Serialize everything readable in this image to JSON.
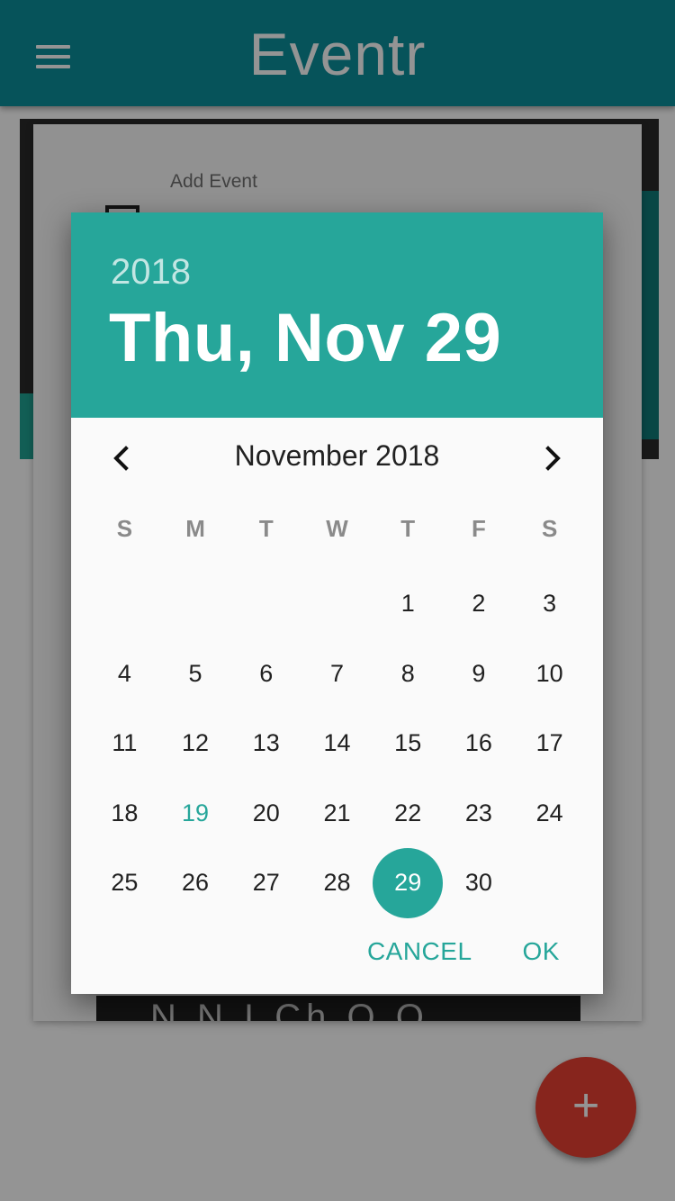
{
  "app_bar": {
    "title": "Eventr"
  },
  "background": {
    "add_event_label": "Add Event",
    "bottom_partial_text": "N N I Ch O O"
  },
  "fab": {
    "label": "+"
  },
  "dialog": {
    "header": {
      "year": "2018",
      "date": "Thu, Nov 29"
    },
    "month_label": "November 2018",
    "weekdays": [
      "S",
      "M",
      "T",
      "W",
      "T",
      "F",
      "S"
    ],
    "leading_blanks": 4,
    "days": [
      "1",
      "2",
      "3",
      "4",
      "5",
      "6",
      "7",
      "8",
      "9",
      "10",
      "11",
      "12",
      "13",
      "14",
      "15",
      "16",
      "17",
      "18",
      "19",
      "20",
      "21",
      "22",
      "23",
      "24",
      "25",
      "26",
      "27",
      "28",
      "29",
      "30"
    ],
    "today": "19",
    "selected": "29",
    "cancel_label": "CANCEL",
    "ok_label": "OK"
  },
  "colors": {
    "accent": "#26a69a",
    "app_bar": "#0b8f9c",
    "fab": "#e84033"
  }
}
